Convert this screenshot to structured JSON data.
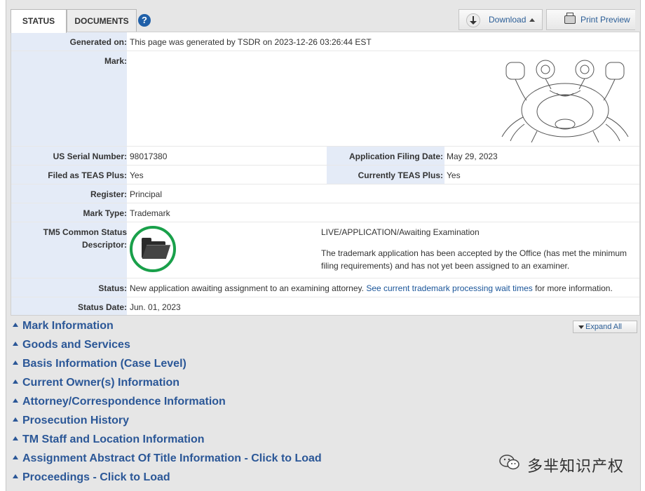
{
  "tabs": [
    {
      "label": "STATUS"
    },
    {
      "label": "DOCUMENTS"
    }
  ],
  "help_glyph": "?",
  "toolbar": {
    "download_label": "Download",
    "print_label": "Print Preview"
  },
  "fields": {
    "generated_on": {
      "label": "Generated on:",
      "value": "This page was generated by TSDR on 2023-12-26 03:26:44 EST"
    },
    "mark": {
      "label": "Mark:"
    },
    "serial": {
      "label": "US Serial Number:",
      "value": "98017380"
    },
    "filing_date": {
      "label": "Application Filing Date:",
      "value": "May 29, 2023"
    },
    "teas_plus": {
      "label": "Filed as TEAS Plus:",
      "value": "Yes"
    },
    "currently_teas": {
      "label": "Currently TEAS Plus:",
      "value": "Yes"
    },
    "register": {
      "label": "Register:",
      "value": "Principal"
    },
    "mark_type": {
      "label": "Mark Type:",
      "value": "Trademark"
    },
    "tm5": {
      "label_line1": "TM5 Common Status",
      "label_line2": "Descriptor:",
      "headline": "LIVE/APPLICATION/Awaiting Examination",
      "desc_line1": "The trademark application has been accepted by the Office (has met the minimum",
      "desc_line2": "filing requirements) and has not yet been assigned to an examiner."
    },
    "status": {
      "label": "Status:",
      "text_before": "New application awaiting assignment to an examining attorney.",
      "link": "See current trademark processing wait times",
      "text_after": "for more information."
    },
    "status_date": {
      "label": "Status Date:",
      "value": "Jun. 01, 2023"
    }
  },
  "expand_all": "Expand All",
  "sections": [
    "Mark Information",
    "Goods and Services",
    "Basis Information (Case Level)",
    "Current Owner(s) Information",
    "Attorney/Correspondence Information",
    "Prosecution History",
    "TM Staff and Location Information",
    "Assignment Abstract Of Title Information - Click to Load",
    "Proceedings - Click to Load"
  ],
  "watermark": {
    "text": "多芈知识产权"
  },
  "colors": {
    "accent": "#2b5797",
    "label_bg": "#e4ebf7",
    "status_ring": "#19a04a"
  }
}
